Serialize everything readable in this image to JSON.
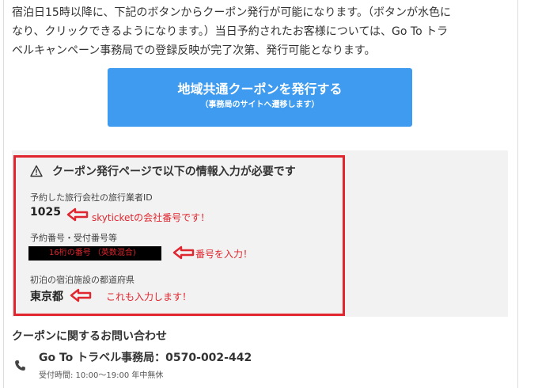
{
  "intro": {
    "line1": "宿泊日15時以降に、下記のボタンからクーポン発行が可能になります。（ボタンが水色に",
    "line2": "なり、クリックできるようになります。）当日予約されたお客様については、Go To トラ",
    "line3": "ベルキャンペーン事務局での登録反映が完了次第、発行可能となります。"
  },
  "issue_button": {
    "label": "地域共通クーポンを発行する",
    "sublabel": "（事務局のサイトへ遷移します）"
  },
  "info_box": {
    "warning_icon": "warning-triangle-icon",
    "warning": "クーポン発行ページで以下の情報入力が必要です",
    "fields": [
      {
        "label": "予約した旅行会社の旅行業者ID",
        "value": "1025",
        "note": "skyticketの会社番号です！"
      },
      {
        "label": "予約番号・受付番号等",
        "value": "16桁の番号 （英数混合)",
        "note": "番号を入力！"
      },
      {
        "label": "初泊の宿泊施設の都道府県",
        "value": "東京都",
        "note": "これも入力します！"
      }
    ]
  },
  "contact": {
    "heading": "クーポンに関するお問い合わせ",
    "phone_icon": "phone-icon",
    "name": "Go To トラベル事務局：0570-002-442",
    "hours": "受付時間: 10:00～19:00 年中無休"
  },
  "colors": {
    "button": "#3e9bef",
    "annotation_red": "#e0262e",
    "panel_bg": "#f2f2f2"
  }
}
